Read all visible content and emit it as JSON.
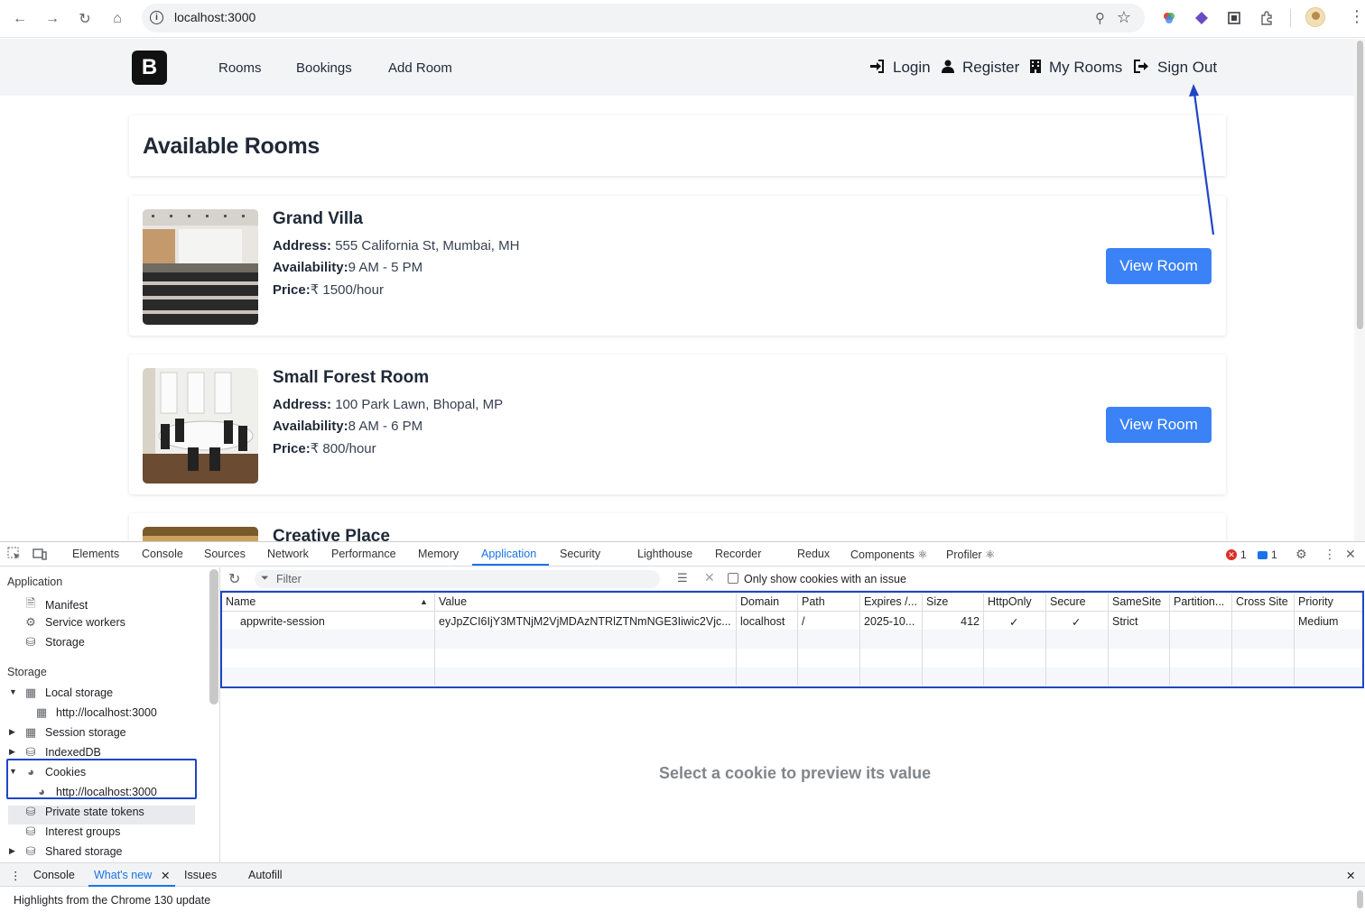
{
  "browser": {
    "url": "localhost:3000"
  },
  "site": {
    "logo_letter": "B",
    "nav_left": [
      "Rooms",
      "Bookings",
      "Add Room"
    ],
    "nav_right": [
      {
        "label": "Login",
        "icon": "sign-in-icon"
      },
      {
        "label": "Register",
        "icon": "user-icon"
      },
      {
        "label": "My Rooms",
        "icon": "building-icon"
      },
      {
        "label": "Sign Out",
        "icon": "sign-out-icon"
      }
    ],
    "page_title": "Available Rooms",
    "rooms": [
      {
        "name": "Grand Villa",
        "address_label": "Address:",
        "address": " 555 California St, Mumbai, MH",
        "availability_label": "Availability:",
        "availability": "9 AM - 5 PM",
        "price_label": "Price:",
        "price": "₹ 1500/hour",
        "button": "View Room"
      },
      {
        "name": "Small Forest Room",
        "address_label": "Address:",
        "address": " 100 Park Lawn, Bhopal, MP",
        "availability_label": "Availability:",
        "availability": "8 AM - 6 PM",
        "price_label": "Price:",
        "price": "₹ 800/hour",
        "button": "View Room"
      },
      {
        "name": "Creative Place"
      }
    ],
    "accent_color": "#3b82f6",
    "annotation_color": "#1f45c6"
  },
  "devtools": {
    "tabs": [
      "Elements",
      "Console",
      "Sources",
      "Network",
      "Performance",
      "Memory",
      "Application",
      "Security",
      "Lighthouse",
      "Recorder",
      "Redux",
      "Components ⚛",
      "Profiler ⚛"
    ],
    "active_tab": "Application",
    "error_count": "1",
    "message_count": "1",
    "sidebar": {
      "application_heading": "Application",
      "application_items": [
        "Manifest",
        "Service workers",
        "Storage"
      ],
      "storage_heading": "Storage",
      "local_storage": "Local storage",
      "local_storage_child": "http://localhost:3000",
      "session_storage": "Session storage",
      "indexeddb": "IndexedDB",
      "cookies": "Cookies",
      "cookies_child": "http://localhost:3000",
      "private_state_tokens": "Private state tokens",
      "interest_groups": "Interest groups",
      "shared_storage": "Shared storage"
    },
    "toolbar": {
      "filter_placeholder": "Filter",
      "only_issues_label": "Only show cookies with an issue"
    },
    "cookie_table": {
      "columns": [
        "Name",
        "Value",
        "Domain",
        "Path",
        "Expires /...",
        "Size",
        "HttpOnly",
        "Secure",
        "SameSite",
        "Partition...",
        "Cross Site",
        "Priority"
      ],
      "rows": [
        {
          "name": "appwrite-session",
          "value": "eyJpZCI6IjY3MTNjM2VjMDAzNTRlZTNmNGE3Iiwic2Vjc...",
          "domain": "localhost",
          "path": "/",
          "expires": "2025-10...",
          "size": "412",
          "httponly": "✓",
          "secure": "✓",
          "samesite": "Strict",
          "partition": "",
          "cross_site": "",
          "priority": "Medium"
        }
      ]
    },
    "preview_text": "Select a cookie to preview its value",
    "drawer": {
      "tabs": [
        "Console",
        "What's new",
        "Issues",
        "Autofill"
      ],
      "active_tab": "What's new",
      "body_text": "Highlights from the Chrome 130 update"
    }
  }
}
